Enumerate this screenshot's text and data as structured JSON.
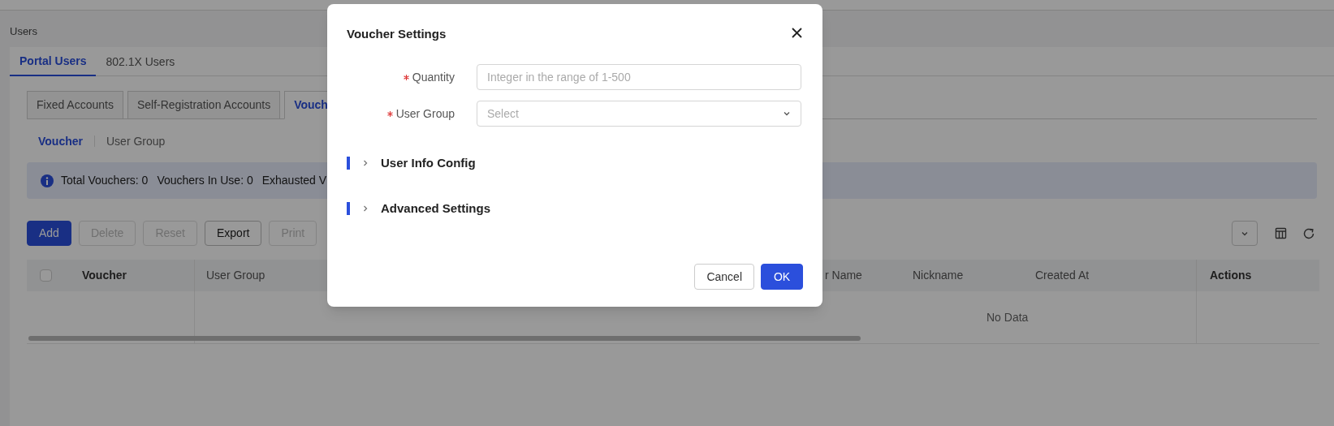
{
  "breadcrumb": "Users",
  "tabs": [
    {
      "label": "Portal Users",
      "selected": true
    },
    {
      "label": "802.1X Users",
      "selected": false
    }
  ],
  "account_tabs": [
    {
      "label": "Fixed Accounts",
      "selected": false
    },
    {
      "label": "Self-Registration Accounts",
      "selected": false
    },
    {
      "label": "Vouch",
      "selected": true
    }
  ],
  "sub_tabs": [
    {
      "label": "Voucher",
      "selected": true
    },
    {
      "label": "User Group",
      "selected": false
    }
  ],
  "info_bar": {
    "stats": [
      "Total Vouchers: 0",
      "Vouchers In Use: 0",
      "Exhausted V"
    ]
  },
  "toolbar": {
    "buttons": [
      {
        "label": "Add",
        "kind": "primary",
        "disabled": false
      },
      {
        "label": "Delete",
        "kind": "default",
        "disabled": true
      },
      {
        "label": "Reset",
        "kind": "default",
        "disabled": true
      },
      {
        "label": "Export",
        "kind": "default",
        "disabled": false
      },
      {
        "label": "Print",
        "kind": "default",
        "disabled": true
      }
    ]
  },
  "table": {
    "select_all": {
      "checked": false
    },
    "columns": [
      "Voucher",
      "User Group",
      "r Name",
      "Nickname",
      "Created At",
      "Actions"
    ],
    "empty_text": "No Data"
  },
  "dialog": {
    "title": "Voucher Settings",
    "fields": [
      {
        "label": "Quantity",
        "required": true,
        "kind": "text",
        "placeholder": "Integer in the range of 1-500"
      },
      {
        "label": "User Group",
        "required": true,
        "kind": "select",
        "placeholder": "Select"
      }
    ],
    "sections": [
      {
        "title": "User Info Config",
        "expanded": false
      },
      {
        "title": "Advanced Settings",
        "expanded": false
      }
    ],
    "buttons": [
      {
        "label": "Cancel",
        "kind": "default"
      },
      {
        "label": "OK",
        "kind": "primary"
      }
    ]
  }
}
